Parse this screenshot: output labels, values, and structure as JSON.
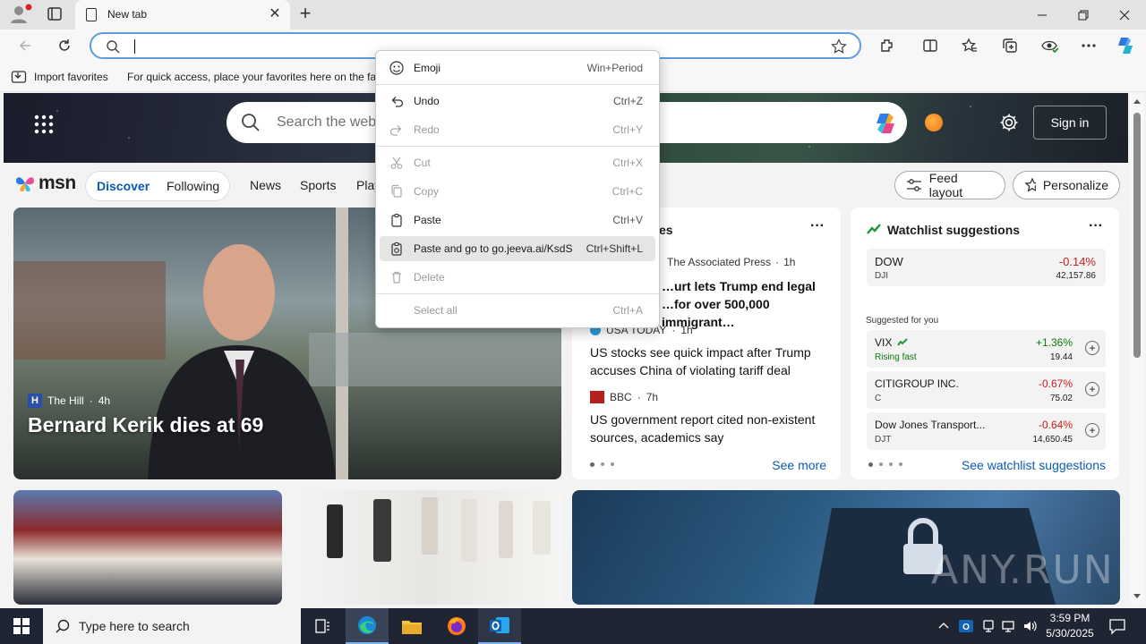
{
  "tab": {
    "title": "New tab"
  },
  "favorites": {
    "import_label": "Import favorites",
    "hint": "For quick access, place your favorites here on the favorites bar."
  },
  "msn": {
    "logo_text": "msn",
    "search_placeholder": "Search the web",
    "sign_in": "Sign in",
    "nav": {
      "discover": "Discover",
      "following": "Following",
      "news": "News",
      "sports": "Sports",
      "play": "Play"
    },
    "feed_layout": "Feed layout",
    "personalize": "Personalize",
    "hero": {
      "source": "The Hill",
      "age": "4h",
      "title": "Bernard Kerik dies at 69"
    },
    "news": {
      "header_suffix": "es",
      "items": [
        {
          "source": "The Associated Press",
          "age": "1h",
          "headline": "…urt lets Trump end legal …for over 500,000 immigrant…"
        },
        {
          "source": "USA TODAY",
          "age": "1h",
          "headline": "US stocks see quick impact after Trump accuses China of violating tariff deal"
        },
        {
          "source": "BBC",
          "age": "7h",
          "headline": "US government report cited non-existent sources, academics say"
        }
      ],
      "see_more": "See more"
    },
    "watchlist": {
      "title": "Watchlist suggestions",
      "top": {
        "symbol": "DOW",
        "sub": "DJI",
        "change": "-0.14%",
        "value": "42,157.86"
      },
      "suggested_label": "Suggested for you",
      "items": [
        {
          "symbol": "VIX",
          "sub": "Rising fast",
          "change": "+1.36%",
          "value": "19.44"
        },
        {
          "symbol": "CITIGROUP INC.",
          "sub": "C",
          "change": "-0.67%",
          "value": "75.02"
        },
        {
          "symbol": "Dow Jones Transport...",
          "sub": "DJT",
          "change": "-0.64%",
          "value": "14,650.45"
        }
      ],
      "see_all": "See watchlist suggestions",
      "colors": {
        "up": "#0b7a0b",
        "down": "#d01c1c"
      }
    }
  },
  "context_menu": {
    "items": [
      {
        "label": "Emoji",
        "shortcut": "Win+Period",
        "icon": "emoji-icon",
        "enabled": true
      },
      {
        "label": "Undo",
        "shortcut": "Ctrl+Z",
        "icon": "undo-icon",
        "enabled": true
      },
      {
        "label": "Redo",
        "shortcut": "Ctrl+Y",
        "icon": "redo-icon",
        "enabled": false
      },
      {
        "label": "Cut",
        "shortcut": "Ctrl+X",
        "icon": "cut-icon",
        "enabled": false
      },
      {
        "label": "Copy",
        "shortcut": "Ctrl+C",
        "icon": "copy-icon",
        "enabled": false
      },
      {
        "label": "Paste",
        "shortcut": "Ctrl+V",
        "icon": "paste-icon",
        "enabled": true
      },
      {
        "label": "Paste and go to go.jeeva.ai/KsdS",
        "shortcut": "Ctrl+Shift+L",
        "icon": "paste-go-icon",
        "enabled": true,
        "highlighted": true
      },
      {
        "label": "Delete",
        "shortcut": "",
        "icon": "delete-icon",
        "enabled": false
      },
      {
        "label": "Select all",
        "shortcut": "Ctrl+A",
        "icon": "",
        "enabled": false
      }
    ]
  },
  "taskbar": {
    "search_placeholder": "Type here to search",
    "time": "3:59 PM",
    "date": "5/30/2025"
  },
  "watermark": "ANY.RUN"
}
